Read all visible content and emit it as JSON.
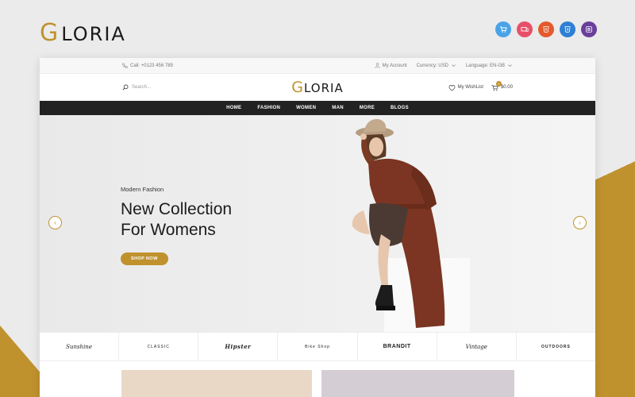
{
  "brand": {
    "logo_initial": "G",
    "logo_rest": "LORIA"
  },
  "badges": [
    {
      "name": "cart-badge-icon",
      "glyph": "🛒",
      "color": "#4aa3e8"
    },
    {
      "name": "responsive-badge-icon",
      "glyph": "▭",
      "color": "#e8506a"
    },
    {
      "name": "html5-badge-icon",
      "glyph": "5",
      "color": "#e45a2b"
    },
    {
      "name": "css3-badge-icon",
      "glyph": "3",
      "color": "#2f7fd4"
    },
    {
      "name": "bootstrap-badge-icon",
      "glyph": "B",
      "color": "#6a3f9c"
    }
  ],
  "topbar": {
    "phone": "Call: +0123 456 789",
    "account": "My Account",
    "currency": "Currency: USD",
    "language": "Language: EN-GB"
  },
  "header": {
    "search_placeholder": "Search...",
    "logo_initial": "G",
    "logo_rest": "LORIA",
    "wishlist": "My WishList",
    "cart_total": "$0.00",
    "cart_count": "0"
  },
  "nav": [
    "HOME",
    "FASHION",
    "WOMEN",
    "MAN",
    "MORE",
    "BLOGS"
  ],
  "hero": {
    "subtitle": "Modern Fashion",
    "title_line1": "New Collection",
    "title_line2": "For Womens",
    "button": "SHOP NOW",
    "prev": "‹",
    "next": "›"
  },
  "brands": [
    "Sunshine",
    "CLASSIC",
    "Hipster",
    "Bike Shop",
    "BRANDIT",
    "Vintage",
    "OUTDOORS"
  ],
  "colors": {
    "accent": "#c0922e",
    "nav_bg": "#222222"
  }
}
